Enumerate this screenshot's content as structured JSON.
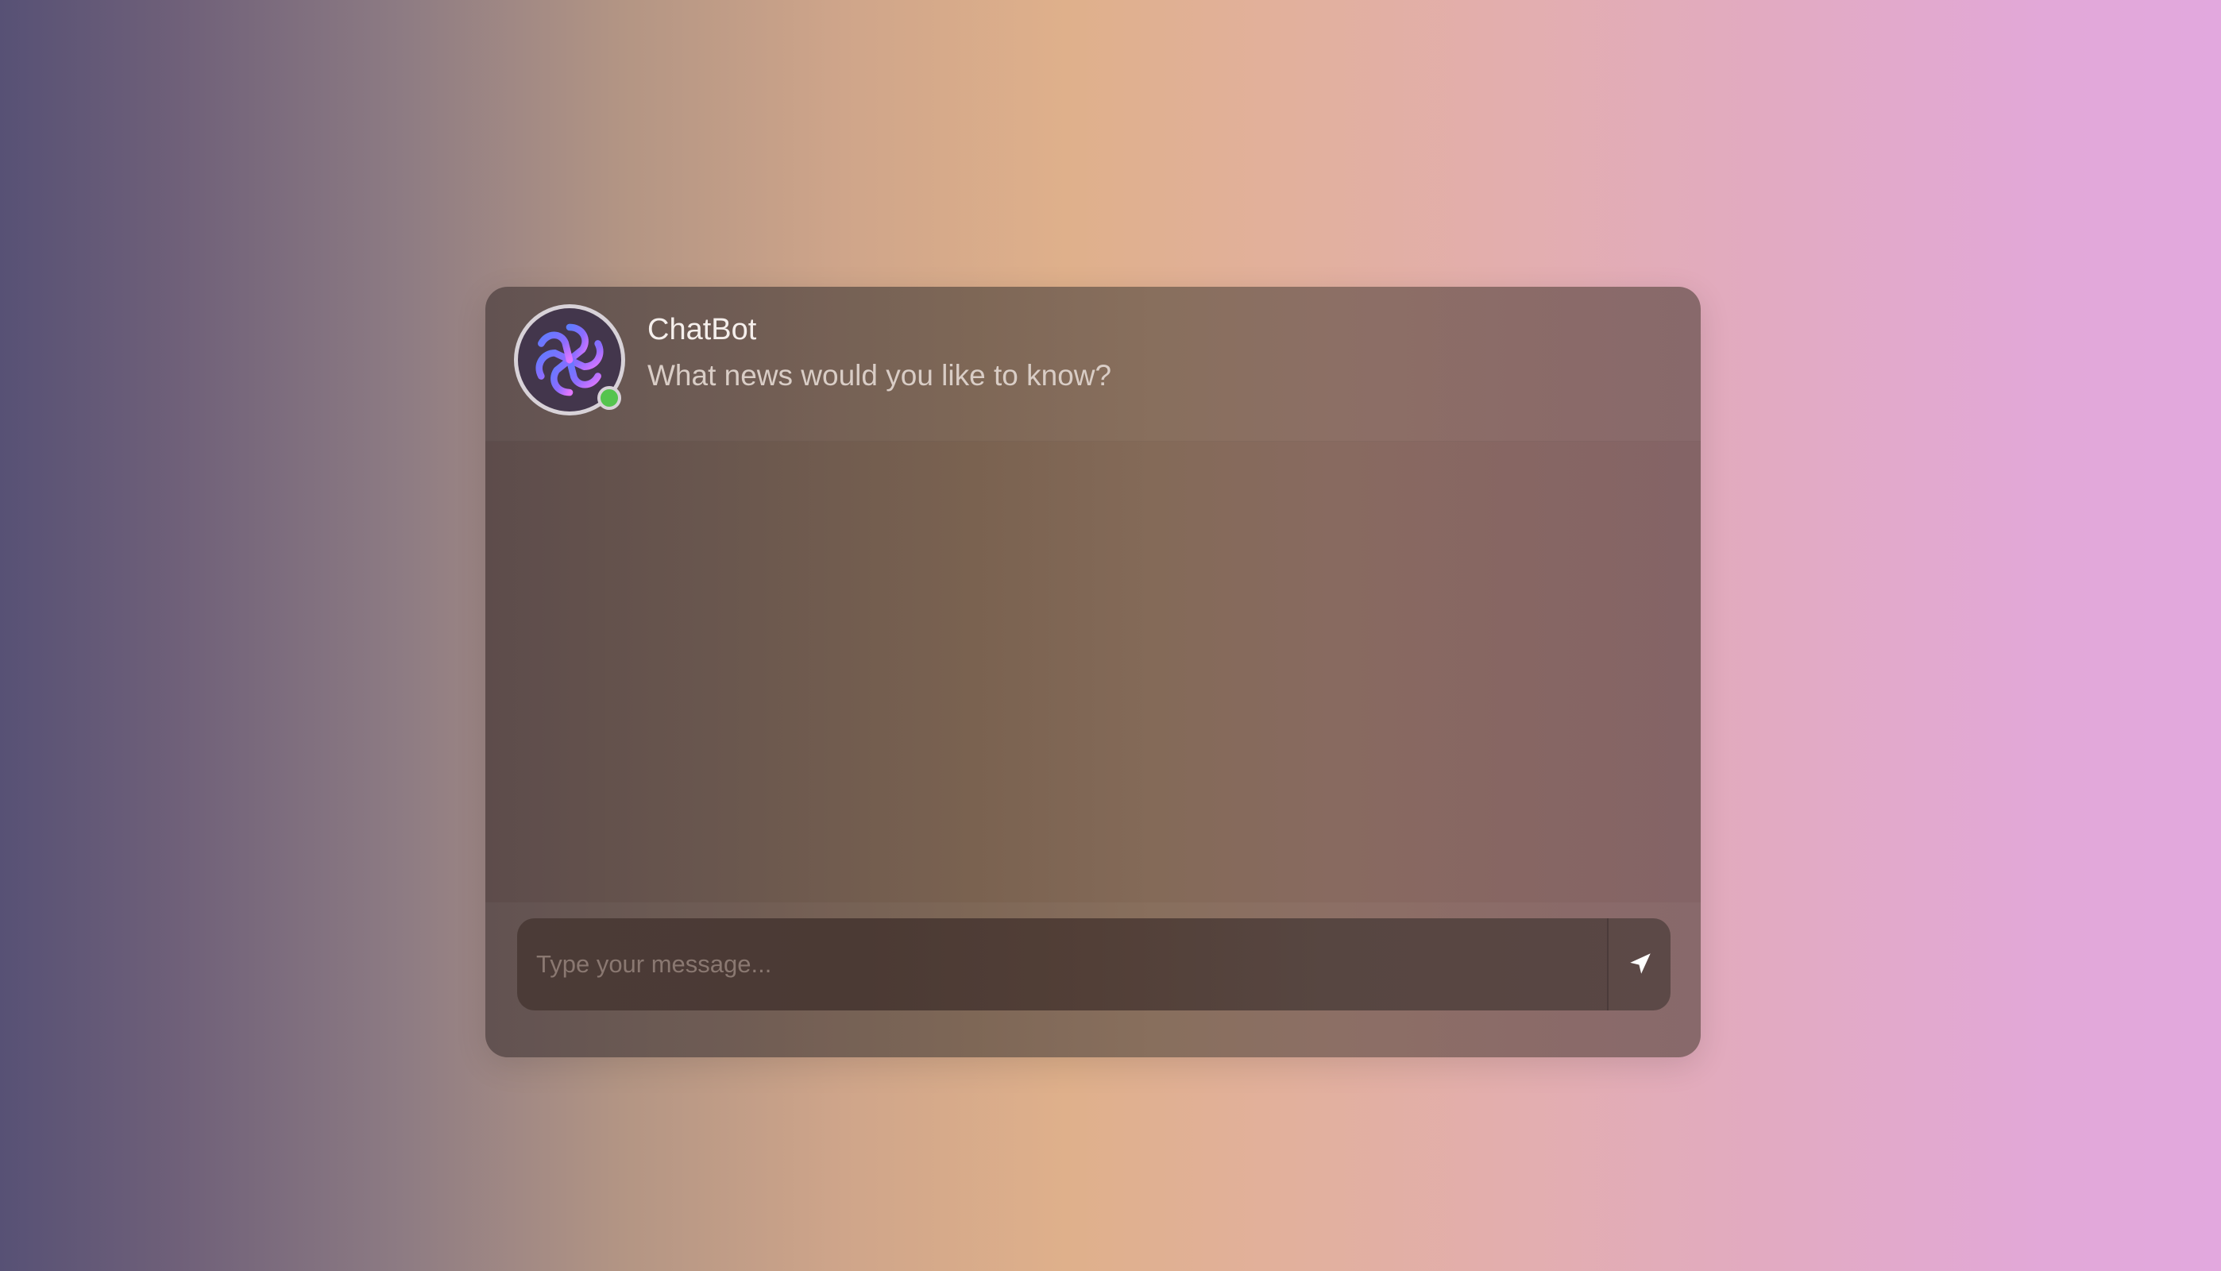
{
  "chat": {
    "bot_name": "ChatBot",
    "bot_status": "What news would you like to know?",
    "avatar_icon": "openai-logo-icon",
    "online_indicator": "online-dot"
  },
  "composer": {
    "placeholder": "Type your message...",
    "value": "",
    "send_icon": "send-arrow-icon"
  },
  "colors": {
    "online": "#55c44e",
    "logo_gradient_start": "#5f7cff",
    "logo_gradient_end": "#e077ff"
  }
}
